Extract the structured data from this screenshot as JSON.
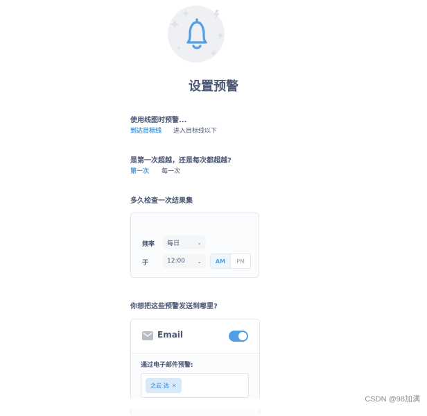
{
  "header": {
    "title": "设置预警",
    "icon": "bell-icon"
  },
  "goal_question": {
    "label": "使用线图时预警...",
    "options": [
      "到达目标线",
      "进入目标线以下"
    ],
    "selected": 0
  },
  "frequency_question": {
    "label": "是第一次超越，还是每次都超越?",
    "options": [
      "第一次",
      "每一次"
    ],
    "selected": 0
  },
  "schedule": {
    "label": "多久检查一次结果集",
    "frequency_label": "频率",
    "frequency_value": "每日",
    "time_label": "于",
    "time_value": "12:00",
    "am": "AM",
    "pm": "PM",
    "selected_period": "AM"
  },
  "channels": {
    "label": "你想把这些预警发送到哪里?",
    "email": {
      "label": "Email",
      "enabled": true,
      "recipients_label": "通过电子邮件预警:",
      "recipients": [
        "之云 达"
      ]
    }
  },
  "watermark": "CSDN @98加满",
  "colors": {
    "accent": "#509ee3",
    "text": "#4c5773",
    "border": "#e4e7eb"
  }
}
